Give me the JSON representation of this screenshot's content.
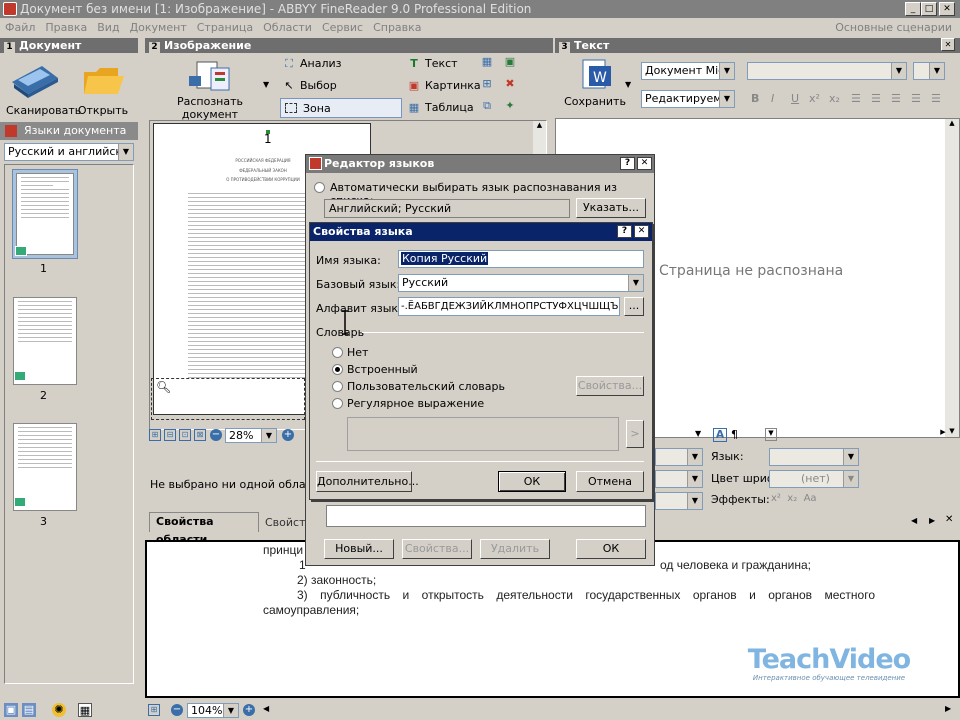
{
  "window": {
    "title": "Документ без имени [1: Изображение] - ABBYY FineReader 9.0 Professional Edition"
  },
  "menu": {
    "items": [
      "Файл",
      "Правка",
      "Вид",
      "Документ",
      "Страница",
      "Области",
      "Сервис",
      "Справка"
    ],
    "right": "Основные сценарии"
  },
  "doc_panel": {
    "num": "1",
    "title": "Документ",
    "scan": "Сканировать",
    "open": "Открыть",
    "langs_label": "Языки документа",
    "lang_value": "Русский и английский",
    "pages": [
      "1",
      "2",
      "3"
    ]
  },
  "image_panel": {
    "num": "2",
    "title": "Изображение",
    "recognize": "Распознать документ",
    "tools": {
      "analyze": "Анализ",
      "select": "Выбор",
      "zone": "Зона распознавания",
      "text": "Текст",
      "picture": "Картинка",
      "table": "Таблица"
    },
    "zoom": "28%",
    "no_area": "Не выбрано ни одной области",
    "tab1": "Свойства области",
    "tab2": "Свойст"
  },
  "text_panel": {
    "num": "3",
    "title": "Текст",
    "save": "Сохранить",
    "format": "Документ Micro",
    "mode": "Редактируемая",
    "not_recognized": "Страница не распознана",
    "lang_label": "Язык:",
    "color_label": "Цвет шрифта:",
    "color_value": "(нет)",
    "effects_label": "Эффекты:"
  },
  "page_thumb": {
    "number": "1",
    "h1": "РОССИЙСКАЯ ФЕДЕРАЦИЯ",
    "h2": "ФЕДЕРАЛЬНЫЙ ЗАКОН",
    "h3": "О ПРОТИВОДЕЙСТВИИ КОРРУПЦИИ"
  },
  "lang_editor": {
    "title": "Редактор языков",
    "auto_label": "Автоматически выбирать язык распознавания из списка:",
    "auto_value": "Английский; Русский",
    "specify": "Указать...",
    "new": "Новый...",
    "props": "Свойства...",
    "delete": "Удалить",
    "ok": "ОК"
  },
  "lang_props": {
    "title": "Свойства языка",
    "name_label": "Имя языка:",
    "name_value": "Копия Русский",
    "base_label": "Базовый язык:",
    "base_value": "Русский",
    "alphabet_label": "Алфавит языка:",
    "alphabet_value": "-.ЁАБВГДЕЖЗИЙКЛМНОПРСТУФХЦЧШЩЪЫ",
    "alphabet_btn": "...",
    "dict_label": "Словарь",
    "dict_options": [
      "Нет",
      "Встроенный",
      "Пользовательский словарь",
      "Регулярное выражение"
    ],
    "dict_selected": "Встроенный",
    "dict_props": "Свойства...",
    "arrow": ">",
    "advanced": "Дополнительно...",
    "ok": "ОК",
    "cancel": "Отмена"
  },
  "bottom_text": {
    "line0": "принци",
    "line1a": "1",
    "line1b": "од человека и гражданина;",
    "line2": "2) законность;",
    "line3": "3) публичность и открытость деятельности государственных органов и органов местного самоуправления;",
    "zoom": "104%"
  },
  "watermark": {
    "brand": "TeachVideo",
    "tagline": "Интерактивное обучающее телевидение"
  }
}
